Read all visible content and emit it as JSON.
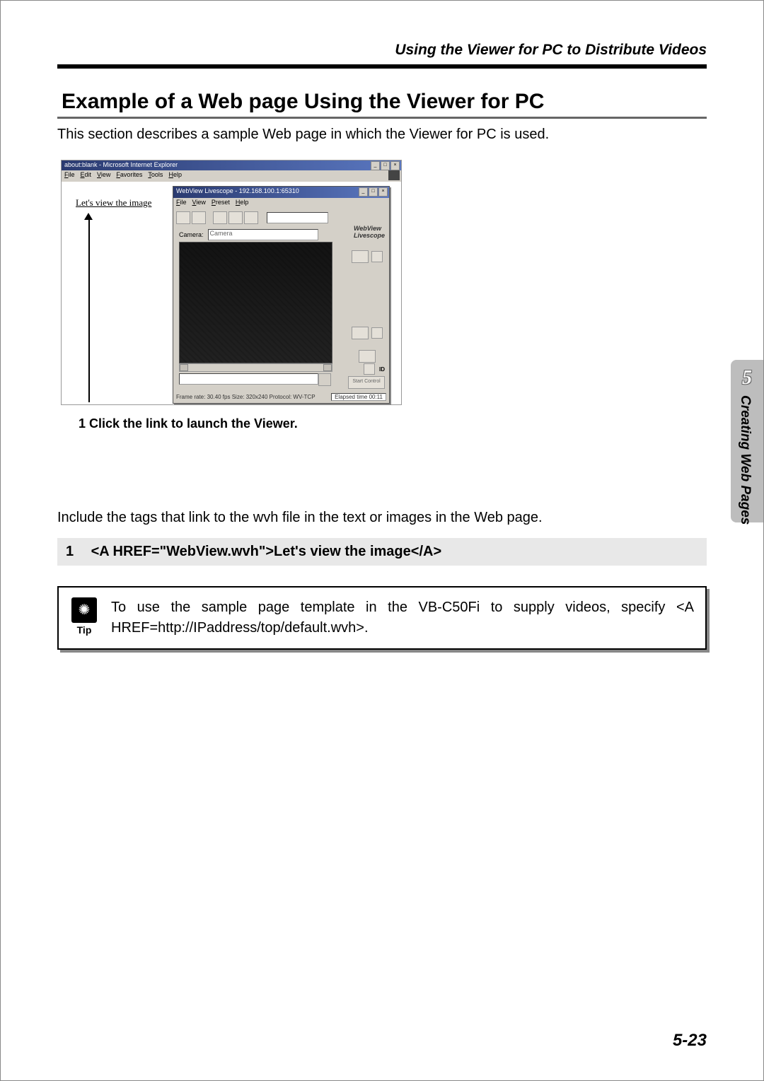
{
  "header": "Using the Viewer for PC to Distribute Videos",
  "section_title": "Example of a Web page Using the Viewer for PC",
  "intro": "This section describes a sample Web page in which the Viewer for PC is used.",
  "ie": {
    "title": "about:blank - Microsoft Internet Explorer",
    "menu": [
      "File",
      "Edit",
      "View",
      "Favorites",
      "Tools",
      "Help"
    ],
    "link": "Let's view the image"
  },
  "viewer": {
    "title": "WebView Livescope - 192.168.100.1:65310",
    "menu": [
      "File",
      "View",
      "Preset",
      "Help"
    ],
    "camera_label": "Camera:",
    "camera_value": "Camera",
    "logo1": "WebView",
    "logo2": "Livescope",
    "start": "Start Control",
    "id_label": "ID",
    "status": "Frame rate: 30.40 fps   Size: 320x240   Protocol: WV-TCP",
    "elapsed": "Elapsed time 00:11"
  },
  "caption": "1  Click the link to launch the Viewer.",
  "body2": "Include the tags that link to the wvh file in the text or images in the Web page.",
  "code": {
    "num": "1",
    "text": "<A HREF=\"WebView.wvh\">Let's view the image</A>"
  },
  "tip": {
    "label": "Tip",
    "text": "To use the sample page template in the VB-C50Fi to supply videos, specify <A HREF=http://IPaddress/top/default.wvh>."
  },
  "sidetab": {
    "num": "5",
    "text": "Creating Web Pages"
  },
  "page_num": "5-23"
}
